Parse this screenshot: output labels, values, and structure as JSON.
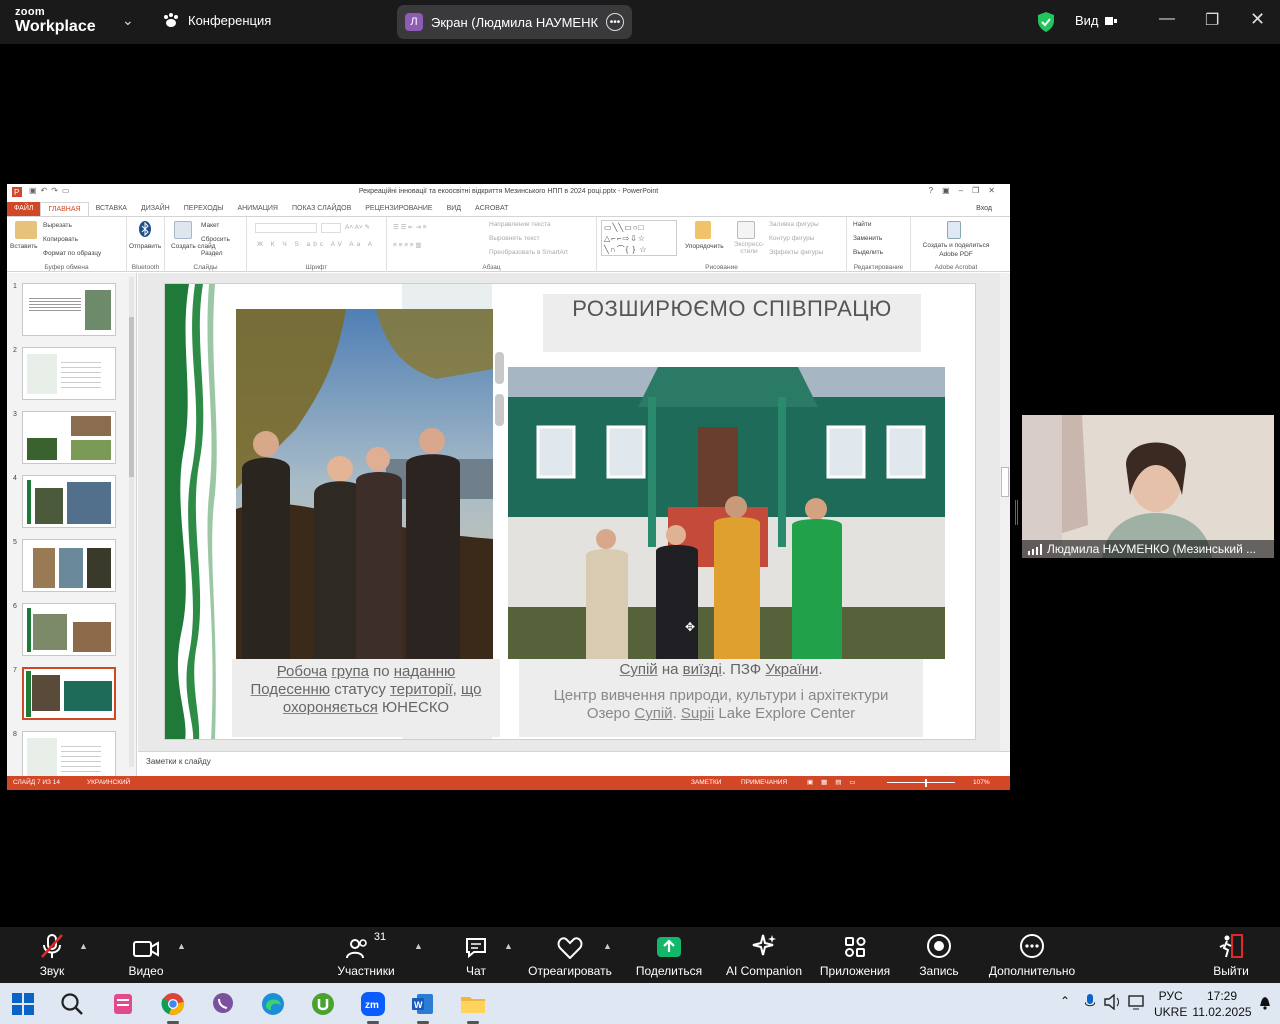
{
  "zoom": {
    "brand_line1": "zoom",
    "brand_line2": "Workplace",
    "conference_label": "Конференция",
    "share_avatar_letter": "Л",
    "share_title": "Экран (Людмила НАУМЕНКО (I",
    "view_label": "Вид",
    "shield_color": "#22c55e",
    "participant_name": "Людмила НАУМЕНКО (Мезинський ...",
    "participants_count": "31",
    "toolbar": {
      "audio": "Звук",
      "video": "Видео",
      "participants": "Участники",
      "chat": "Чат",
      "react": "Отреагировать",
      "share": "Поделиться",
      "ai": "AI Companion",
      "apps": "Приложения",
      "record": "Запись",
      "more": "Дополнительно",
      "leave": "Выйти"
    }
  },
  "ppt": {
    "title": "Рекреаційні інновації та екоосвітні відкриття Мезинського НПП в 2024 році.pptx - PowerPoint",
    "login": "Вход",
    "tabs": [
      "ФАЙЛ",
      "ГЛАВНАЯ",
      "ВСТАВКА",
      "ДИЗАЙН",
      "ПЕРЕХОДЫ",
      "АНИМАЦИЯ",
      "ПОКАЗ СЛАЙДОВ",
      "РЕЦЕНЗИРОВАНИЕ",
      "ВИД",
      "ACROBAT"
    ],
    "ribbon": {
      "paste": "Вставить",
      "cut": "Вырезать",
      "copy": "Копировать",
      "format_painter": "Формат по образцу",
      "clipboard": "Буфер обмена",
      "send": "Отправить",
      "bluetooth": "Bluetooth",
      "new_slide": "Создать слайд",
      "layout": "Макет",
      "reset": "Сбросить",
      "section": "Раздел",
      "slides": "Слайды",
      "font": "Шрифт",
      "text_direction": "Направление текста",
      "align_text": "Выровнять текст",
      "smartart": "Преобразовать в SmartArt",
      "paragraph": "Абзац",
      "arrange": "Упорядочить",
      "quick_styles": "Экспресс-стили",
      "shape_fill": "Заливка фигуры",
      "shape_outline": "Контур фигуры",
      "shape_effects": "Эффекты фигуры",
      "drawing": "Рисование",
      "find": "Найти",
      "replace": "Заменить",
      "select": "Выделить",
      "editing": "Редактирование",
      "adobe_create": "Создать и поделиться Adobe PDF",
      "adobe": "Adobe Acrobat"
    },
    "thumb_numbers": [
      "1",
      "2",
      "3",
      "4",
      "5",
      "6",
      "7",
      "8"
    ],
    "notes_placeholder": "Заметки к слайду",
    "status_slide": "СЛАЙД 7 ИЗ 14",
    "status_lang": "УКРАИНСКИЙ",
    "status_notes": "ЗАМЕТКИ",
    "status_comments": "ПРИМЕЧАНИЯ",
    "zoom_level": "107%"
  },
  "slide": {
    "title": "РОЗШИРЮЄМО СПІВПРАЦЮ",
    "left_caption": {
      "w1": "Робоча",
      "w2": "група",
      "w3": " по ",
      "w4": "наданню",
      "w5": "Подесенню",
      "w6": " статусу ",
      "w7": "території",
      "w8": ", ",
      "w9": "що",
      "w10": "охороняється",
      "w11": " ЮНЕСКО"
    },
    "right_caption": {
      "a1": "Супій",
      "a2": " на ",
      "a3": "виїзді",
      "a4": ". ПЗФ ",
      "a5": "України",
      "a6": ".",
      "b": "Центр вивчення природи, культури і архітектури",
      "c1": "Озеро ",
      "c2": "Супій",
      "c3": ". ",
      "c4": "Supii",
      "c5": " Lake Explore Center"
    }
  },
  "taskbar": {
    "lang_top": "РУС",
    "lang_bottom": "UKRE",
    "time": "17:29",
    "date": "11.02.2025"
  },
  "colors": {
    "ppt_accent": "#d24726",
    "slide_green": "#1f7a3a",
    "share_green": "#12b76a"
  }
}
